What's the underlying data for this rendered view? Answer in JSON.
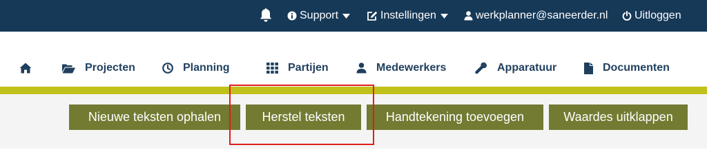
{
  "topbar": {
    "notifications_icon": "bell-icon",
    "support_label": "Support",
    "settings_label": "Instellingen",
    "user_email": "werkplanner@saneerder.nl",
    "logout_label": "Uitloggen"
  },
  "nav": {
    "items": [
      {
        "icon": "home-icon",
        "label": ""
      },
      {
        "icon": "folder-open-icon",
        "label": "Projecten"
      },
      {
        "icon": "clock-icon",
        "label": "Planning"
      },
      {
        "icon": "grid-icon",
        "label": "Partijen"
      },
      {
        "icon": "user-icon",
        "label": "Medewerkers"
      },
      {
        "icon": "wrench-icon",
        "label": "Apparatuur"
      },
      {
        "icon": "document-icon",
        "label": "Documenten"
      }
    ]
  },
  "actions": {
    "fetch_texts": "Nieuwe teksten ophalen",
    "restore_texts": "Herstel teksten",
    "add_signature": "Handtekening toevoegen",
    "expand_values": "Waardes uitklappen"
  },
  "colors": {
    "topbar": "#173958",
    "nav_text": "#1f3f5e",
    "accent_line": "#c1c11b",
    "button": "#737a32",
    "highlight": "#e01c1c"
  }
}
